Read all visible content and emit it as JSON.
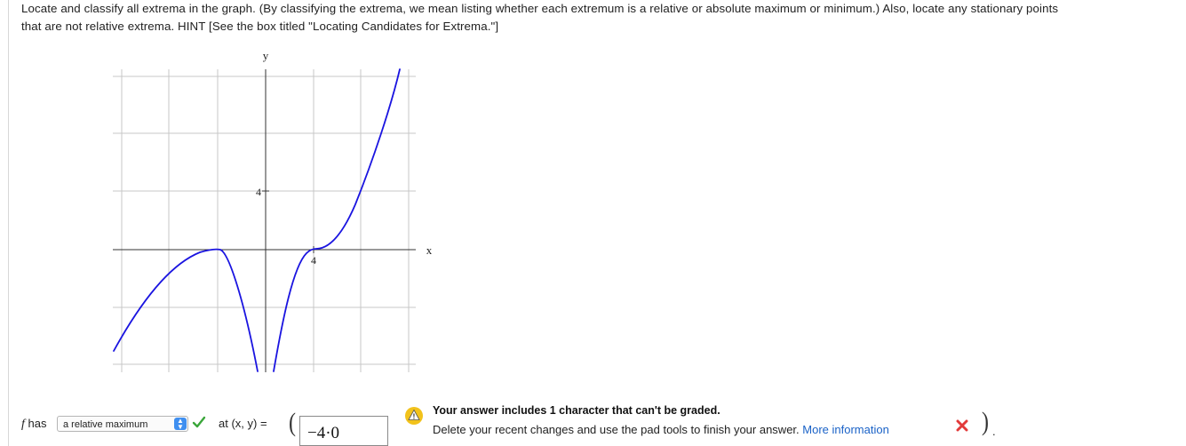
{
  "question": {
    "line1": "Locate and classify all extrema in the graph. (By classifying the extrema, we mean listing whether each extremum is a relative or absolute maximum or minimum.) Also, locate any stationary points",
    "line2": "that are not relative extrema. HINT [See the box titled \"Locating Candidates for Extrema.\"]"
  },
  "graph": {
    "y_axis_label": "y",
    "x_axis_label": "x",
    "y_tick_label": "4",
    "x_tick_label": "4",
    "curve_color": "#1a14e0"
  },
  "answer": {
    "f_label": "f",
    "has_label": " has",
    "selected_option": "a relative maximum",
    "at_label": "at (x, y) =",
    "point_value": "−4·0",
    "close_paren": ")",
    "trailing": "."
  },
  "warning": {
    "title": "Your answer includes 1 character that can't be graded.",
    "body": "Delete your recent changes and use the pad tools to finish your answer.",
    "link": "More information"
  },
  "colors": {
    "check": "#3aa63a",
    "warn": "#f2c21b",
    "error": "#e23a3a",
    "link": "#1a62c7"
  }
}
